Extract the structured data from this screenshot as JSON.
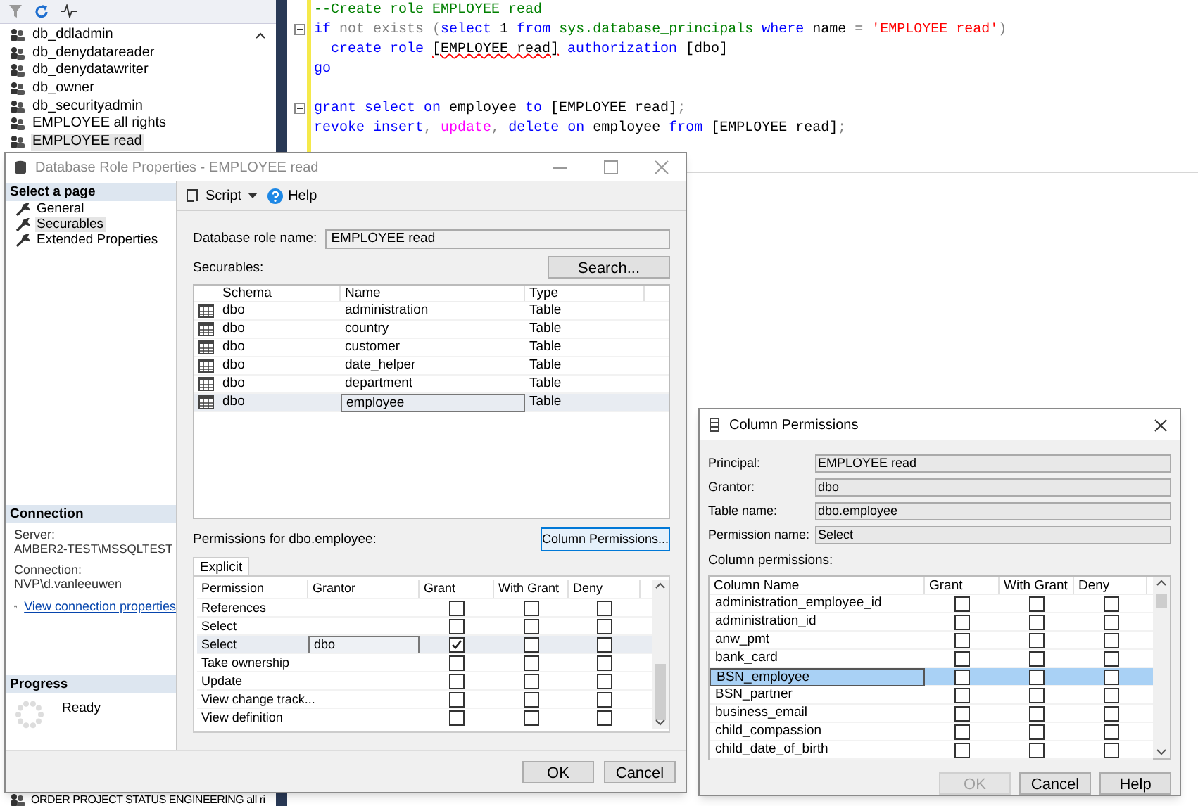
{
  "object_explorer": {
    "items": [
      {
        "label": "db_ddladmin",
        "selected": false
      },
      {
        "label": "db_denydatareader",
        "selected": false
      },
      {
        "label": "db_denydatawriter",
        "selected": false
      },
      {
        "label": "db_owner",
        "selected": false
      },
      {
        "label": "db_securityadmin",
        "selected": false
      },
      {
        "label": "EMPLOYEE all rights",
        "selected": false
      },
      {
        "label": "EMPLOYEE read",
        "selected": true
      }
    ],
    "bottom_item": "ORDER PROJECT STATUS ENGINEERING all ri"
  },
  "editor": {
    "lines": [
      {
        "fold": false,
        "indented": false,
        "tokens": [
          {
            "text": "--Create role EMPLOYEE read",
            "kind": "comment"
          }
        ]
      },
      {
        "fold": true,
        "indented": false,
        "tokens": [
          {
            "text": "if ",
            "kind": "keyword"
          },
          {
            "text": "not exists (",
            "kind": "operator"
          },
          {
            "text": "select ",
            "kind": "keyword"
          },
          {
            "text": "1 ",
            "kind": "plain"
          },
          {
            "text": "from ",
            "kind": "keyword"
          },
          {
            "text": "sys.database_principals ",
            "kind": "system"
          },
          {
            "text": "where ",
            "kind": "keyword"
          },
          {
            "text": "name ",
            "kind": "plain"
          },
          {
            "text": "= ",
            "kind": "operator"
          },
          {
            "text": "'EMPLOYEE read'",
            "kind": "string"
          },
          {
            "text": ")",
            "kind": "operator"
          }
        ]
      },
      {
        "fold": false,
        "indented": true,
        "tokens": [
          {
            "text": "create role ",
            "kind": "keyword"
          },
          {
            "text": "[EMPLOYEE read]",
            "kind": "error"
          },
          {
            "text": " authorization ",
            "kind": "keyword"
          },
          {
            "text": "[dbo]",
            "kind": "plain"
          }
        ]
      },
      {
        "fold": false,
        "indented": false,
        "tokens": [
          {
            "text": "go",
            "kind": "keyword"
          }
        ]
      },
      {
        "fold": false
      },
      {
        "fold": true,
        "indented": false,
        "tokens": [
          {
            "text": "grant select on ",
            "kind": "keyword"
          },
          {
            "text": "employee ",
            "kind": "plain"
          },
          {
            "text": "to ",
            "kind": "keyword"
          },
          {
            "text": "[EMPLOYEE read]",
            "kind": "plain"
          },
          {
            "text": ";",
            "kind": "operator"
          }
        ]
      },
      {
        "fold": false,
        "indented": false,
        "tokens": [
          {
            "text": "revoke insert",
            "kind": "keyword"
          },
          {
            "text": ", ",
            "kind": "operator"
          },
          {
            "text": "update",
            "kind": "function"
          },
          {
            "text": ", ",
            "kind": "operator"
          },
          {
            "text": "delete on ",
            "kind": "keyword"
          },
          {
            "text": "employee ",
            "kind": "plain"
          },
          {
            "text": "from ",
            "kind": "keyword"
          },
          {
            "text": "[EMPLOYEE read]",
            "kind": "plain"
          },
          {
            "text": ";",
            "kind": "operator"
          }
        ]
      }
    ]
  },
  "role_dialog": {
    "title": "Database Role Properties - EMPLOYEE read",
    "nav_header": "Select a page",
    "pages": [
      {
        "label": "General",
        "selected": false
      },
      {
        "label": "Securables",
        "selected": true
      },
      {
        "label": "Extended Properties",
        "selected": false
      }
    ],
    "toolbar": {
      "script": "Script",
      "help": "Help"
    },
    "role_name_label": "Database role name:",
    "role_name": "EMPLOYEE read",
    "securables_label": "Securables:",
    "search_button": "Search...",
    "securables": {
      "columns": [
        "Schema",
        "Name",
        "Type"
      ],
      "rows": [
        {
          "schema": "dbo",
          "name": "administration",
          "type": "Table",
          "selected": false
        },
        {
          "schema": "dbo",
          "name": "country",
          "type": "Table",
          "selected": false
        },
        {
          "schema": "dbo",
          "name": "customer",
          "type": "Table",
          "selected": false
        },
        {
          "schema": "dbo",
          "name": "date_helper",
          "type": "Table",
          "selected": false
        },
        {
          "schema": "dbo",
          "name": "department",
          "type": "Table",
          "selected": false
        },
        {
          "schema": "dbo",
          "name": "employee",
          "type": "Table",
          "selected": true
        }
      ]
    },
    "permissions_label": "Permissions for dbo.employee:",
    "column_permissions_button": "Column Permissions...",
    "tab": "Explicit",
    "permissions": {
      "columns": [
        "Permission",
        "Grantor",
        "Grant",
        "With Grant",
        "Deny"
      ],
      "rows": [
        {
          "permission": "References",
          "grantor": "",
          "grant": false,
          "with_grant": false,
          "deny": false,
          "selected": false
        },
        {
          "permission": "Select",
          "grantor": "",
          "grant": false,
          "with_grant": false,
          "deny": false,
          "selected": false
        },
        {
          "permission": "Select",
          "grantor": "dbo",
          "grant": true,
          "with_grant": false,
          "deny": false,
          "selected": true
        },
        {
          "permission": "Take ownership",
          "grantor": "",
          "grant": false,
          "with_grant": false,
          "deny": false,
          "selected": false
        },
        {
          "permission": "Update",
          "grantor": "",
          "grant": false,
          "with_grant": false,
          "deny": false,
          "selected": false
        },
        {
          "permission": "View change track...",
          "grantor": "",
          "grant": false,
          "with_grant": false,
          "deny": false,
          "selected": false
        },
        {
          "permission": "View definition",
          "grantor": "",
          "grant": false,
          "with_grant": false,
          "deny": false,
          "selected": false
        }
      ]
    },
    "connection": {
      "header": "Connection",
      "server_label": "Server:",
      "server": "AMBER2-TEST\\MSSQLTEST",
      "connection_label": "Connection:",
      "connection": "NVP\\d.vanleeuwen",
      "link": "View connection properties"
    },
    "progress": {
      "header": "Progress",
      "status": "Ready"
    },
    "buttons": [
      {
        "label": "OK",
        "disabled": false
      },
      {
        "label": "Cancel",
        "disabled": false
      }
    ]
  },
  "column_dialog": {
    "title": "Column Permissions",
    "fields": [
      {
        "label": "Principal:",
        "value": "EMPLOYEE read"
      },
      {
        "label": "Grantor:",
        "value": "dbo"
      },
      {
        "label": "Table name:",
        "value": "dbo.employee"
      },
      {
        "label": "Permission name:",
        "value": "Select"
      }
    ],
    "grid_label": "Column permissions:",
    "columns": [
      "Column Name",
      "Grant",
      "With Grant",
      "Deny"
    ],
    "rows": [
      {
        "name": "administration_employee_id",
        "grant": false,
        "with_grant": false,
        "deny": false,
        "selected": false
      },
      {
        "name": "administration_id",
        "grant": false,
        "with_grant": false,
        "deny": false,
        "selected": false
      },
      {
        "name": "anw_pmt",
        "grant": false,
        "with_grant": false,
        "deny": false,
        "selected": false
      },
      {
        "name": "bank_card",
        "grant": false,
        "with_grant": false,
        "deny": false,
        "selected": false
      },
      {
        "name": "BSN_employee",
        "grant": false,
        "with_grant": false,
        "deny": false,
        "selected": true
      },
      {
        "name": "BSN_partner",
        "grant": false,
        "with_grant": false,
        "deny": false,
        "selected": false
      },
      {
        "name": "business_email",
        "grant": false,
        "with_grant": false,
        "deny": false,
        "selected": false
      },
      {
        "name": "child_compassion",
        "grant": false,
        "with_grant": false,
        "deny": false,
        "selected": false
      },
      {
        "name": "child_date_of_birth",
        "grant": false,
        "with_grant": false,
        "deny": false,
        "selected": false
      }
    ],
    "buttons": [
      {
        "label": "OK",
        "disabled": true
      },
      {
        "label": "Cancel",
        "disabled": false
      },
      {
        "label": "Help",
        "disabled": false
      }
    ]
  }
}
